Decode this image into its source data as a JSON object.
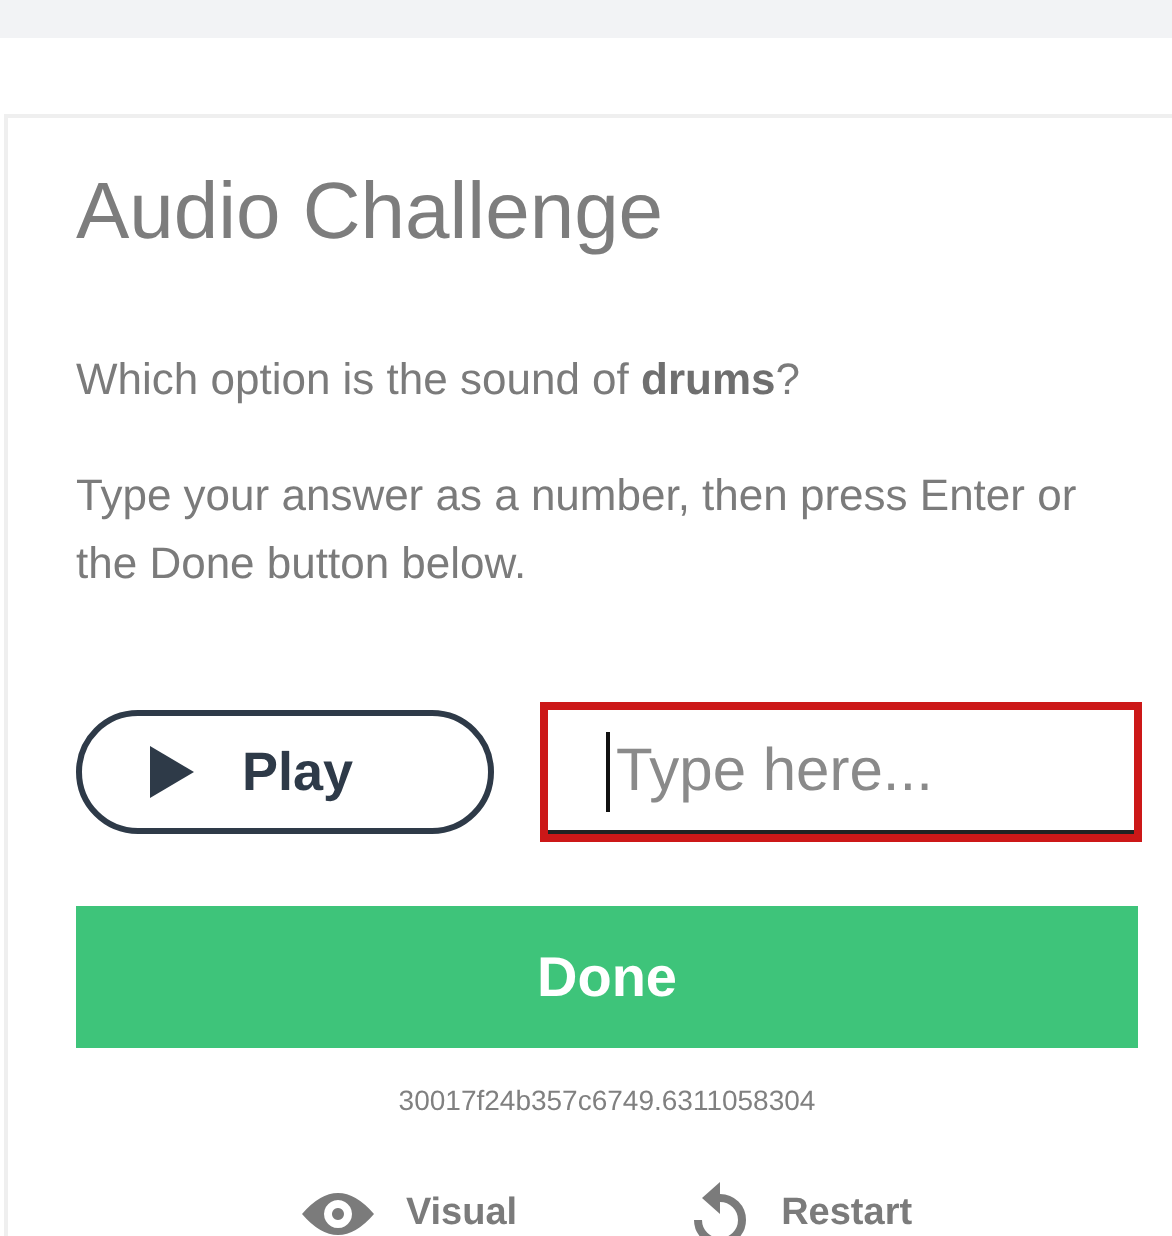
{
  "title": "Audio Challenge",
  "question": "Which option is the sound of **drums**?",
  "instructions": "Type your answer as a number, then press Enter or the Done button below.",
  "play_button": {
    "label": "Play"
  },
  "answer_field": {
    "placeholder": "Type here...",
    "focused": true
  },
  "done_button": {
    "label": "Done"
  },
  "challenge_id": "30017f24b357c6749.6311058304",
  "links": [
    {
      "kind": "visual",
      "label": "Visual"
    },
    {
      "kind": "restart",
      "label": "Restart"
    }
  ]
}
